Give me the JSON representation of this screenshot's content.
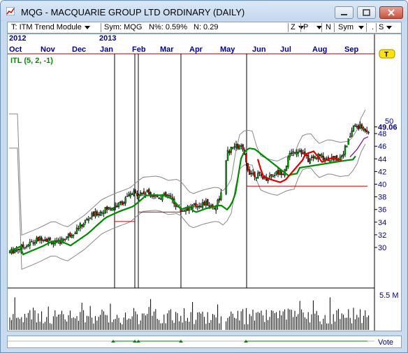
{
  "window": {
    "title": "MQG - MACQUARIE GROUP LTD  ORDINARY (DAILY)",
    "accent": "#c3d7ee"
  },
  "toolbar": {
    "strategy": "T: ITM Trend Module",
    "symbol": "Sym: MQG",
    "n_pct": "N%: 0.59%",
    "n_value": "N: 0.29",
    "zoom_label": "Z",
    "p_label": "P",
    "n_label": "N",
    "sym_label": "Sym",
    "dot_label": ".",
    "s_label": "S"
  },
  "chart": {
    "year_labels": [
      "2012",
      "2013"
    ],
    "month_labels": [
      "Oct",
      "Nov",
      "Dec",
      "Jan",
      "Feb",
      "Mar",
      "Apr",
      "May",
      "Jun",
      "Jul",
      "Aug",
      "Sep"
    ],
    "indicator_label": "ITL (5, 2, -1)",
    "price_ticks": [
      "50",
      "49.06",
      "48",
      "46",
      "44",
      "42",
      "40",
      "38",
      "36",
      "34",
      "32",
      "30"
    ],
    "current_price": "49.06",
    "t_marker": "T",
    "volume_label": "5.5 M",
    "vote_label": "Vote",
    "colors": {
      "up_candle": "#00a000",
      "down_candle": "#c00000",
      "itl_up": "#008a00",
      "itl_down": "#e00000",
      "bands": "#888888",
      "reference_lines": "#d00000",
      "vote_marker": "#008a00",
      "price_line": "#800080"
    }
  }
}
